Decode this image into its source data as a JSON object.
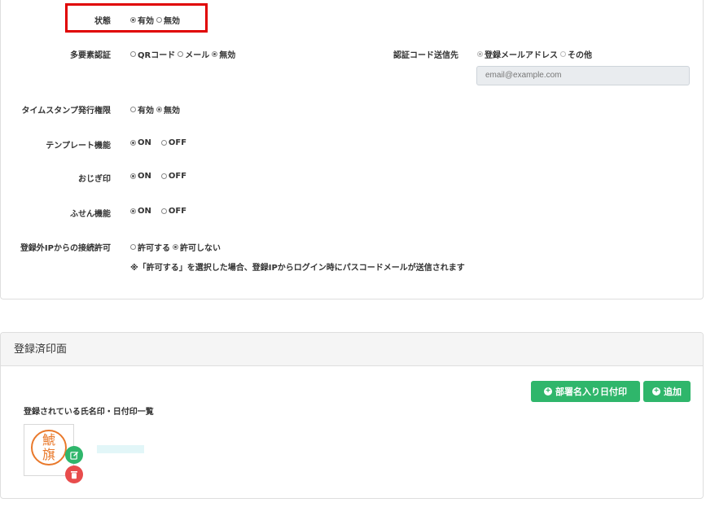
{
  "settings": {
    "status": {
      "label": "状態",
      "options": [
        "有効",
        "無効"
      ],
      "selected": 0
    },
    "mfa": {
      "label": "多要素認証",
      "options": [
        "QRコード",
        "メール",
        "無効"
      ],
      "selected": 2
    },
    "auth_dest": {
      "label": "認証コード送信先",
      "options": [
        "登録メールアドレス",
        "その他"
      ],
      "selected": 0,
      "email_placeholder": "email@example.com"
    },
    "timestamp": {
      "label": "タイムスタンプ発行権限",
      "options": [
        "有効",
        "無効"
      ],
      "selected": 1
    },
    "template": {
      "label": "テンプレート機能",
      "options": [
        "ON",
        "OFF"
      ],
      "selected": 0
    },
    "ojigi": {
      "label": "おじぎ印",
      "options": [
        "ON",
        "OFF"
      ],
      "selected": 0
    },
    "fusen": {
      "label": "ふせん機能",
      "options": [
        "ON",
        "OFF"
      ],
      "selected": 0
    },
    "ip": {
      "label": "登録外IPからの接続許可",
      "options": [
        "許可する",
        "許可しない"
      ],
      "selected": 1,
      "note": "※「許可する」を選択した場合、登録IPからログイン時にパスコードメールが送信されます"
    }
  },
  "stamps": {
    "title": "登録済印面",
    "list_title": "登録されている氏名印・日付印一覧",
    "btn_dept_date": "部署名入り日付印",
    "btn_add": "追加",
    "seal_text": "鯱旗"
  },
  "colors": {
    "accent_green": "#2fb66b",
    "danger_red": "#e84c4c",
    "highlight_red": "#e00000"
  },
  "icons": [
    "plus-circle-icon",
    "edit-icon",
    "trash-icon"
  ]
}
